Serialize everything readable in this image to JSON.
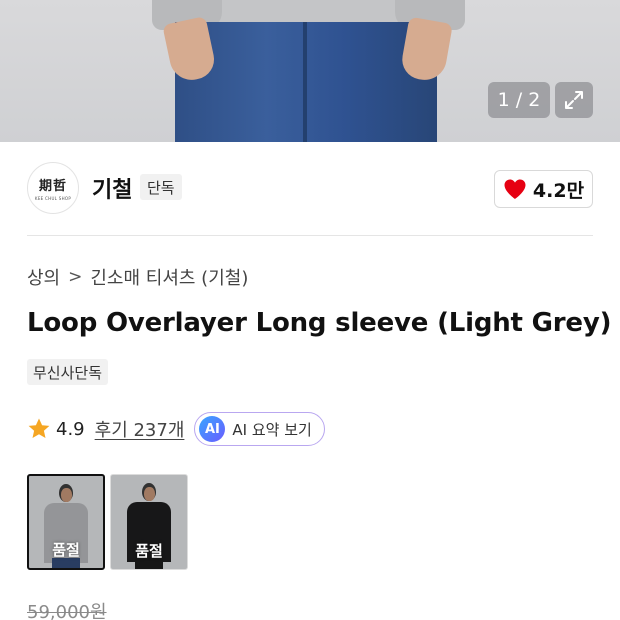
{
  "gallery": {
    "pager_text": "1 / 2",
    "current_index": 1,
    "total": 2
  },
  "brand": {
    "logo_text": "期哲",
    "logo_subtext": "KEE CHUL SHOP",
    "name": "기철",
    "exclusive_tag": "단독"
  },
  "like": {
    "count": "4.2만",
    "heart_color": "#e60012"
  },
  "breadcrumb": {
    "category": "상의",
    "separator": ">",
    "subcategory": "긴소매 티셔츠 (기철)"
  },
  "product": {
    "title": "Loop Overlayer Long sleeve (Light Grey)",
    "badge": "무신사단독"
  },
  "rating": {
    "score": "4.9",
    "star_color": "#f5a623",
    "review_link": "후기 237개",
    "ai_badge": "AI",
    "ai_button_label": "AI 요약 보기"
  },
  "variants": [
    {
      "color_name": "light grey",
      "status": "품절",
      "selected": true
    },
    {
      "color_name": "black",
      "status": "품절",
      "selected": false
    }
  ],
  "price": {
    "original": "59,000원"
  }
}
